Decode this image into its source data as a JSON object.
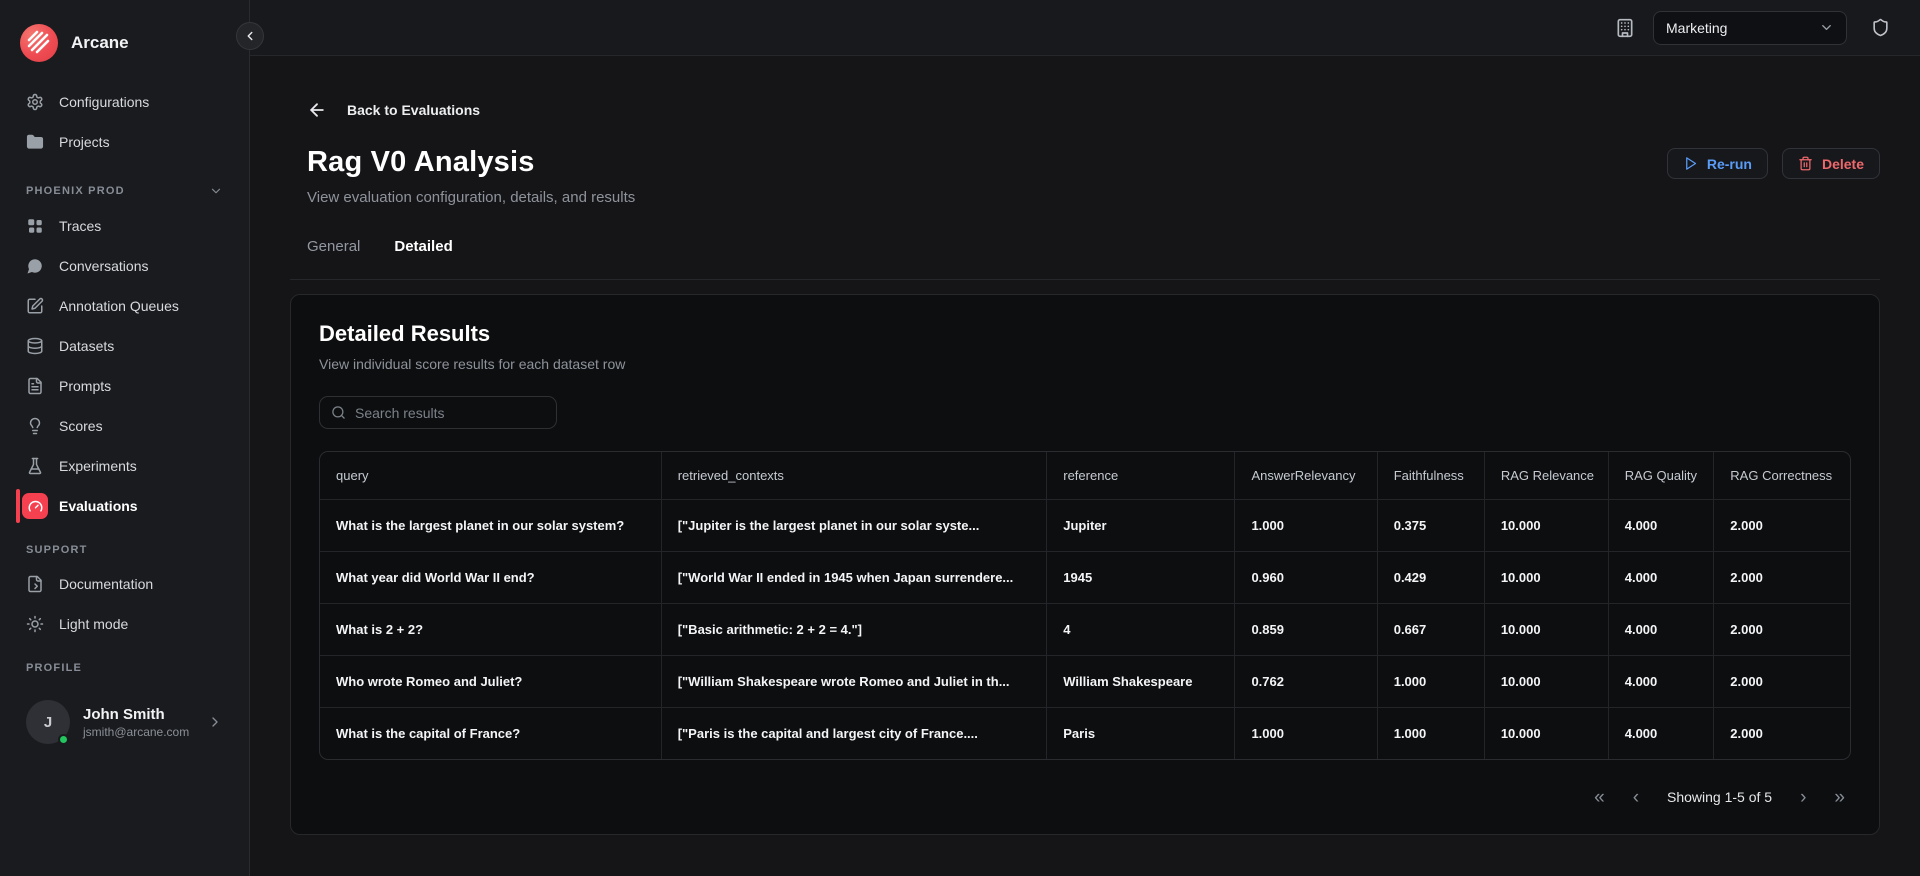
{
  "brand": {
    "name": "Arcane"
  },
  "topbar": {
    "org_selector_value": "Marketing"
  },
  "sidebar": {
    "main_items": [
      {
        "label": "Configurations",
        "icon": "gear-icon"
      },
      {
        "label": "Projects",
        "icon": "folder-icon"
      }
    ],
    "project_section_label": "PHOENIX PROD",
    "project_items": [
      {
        "label": "Traces",
        "icon": "grid-icon"
      },
      {
        "label": "Conversations",
        "icon": "chat-bubble-icon"
      },
      {
        "label": "Annotation Queues",
        "icon": "annotation-icon"
      },
      {
        "label": "Datasets",
        "icon": "database-icon"
      },
      {
        "label": "Prompts",
        "icon": "prompt-file-icon"
      },
      {
        "label": "Scores",
        "icon": "lightbulb-icon"
      },
      {
        "label": "Experiments",
        "icon": "flask-icon"
      },
      {
        "label": "Evaluations",
        "icon": "gauge-icon",
        "active": true
      }
    ],
    "support_section_label": "SUPPORT",
    "support_items": [
      {
        "label": "Documentation",
        "icon": "document-icon"
      },
      {
        "label": "Light mode",
        "icon": "sun-icon"
      }
    ],
    "profile_section_label": "PROFILE",
    "profile": {
      "initial": "J",
      "name": "John Smith",
      "email": "jsmith@arcane.com"
    }
  },
  "header": {
    "back_label": "Back to Evaluations",
    "title": "Rag V0 Analysis",
    "subtitle": "View evaluation configuration, details, and results",
    "rerun_label": "Re-run",
    "delete_label": "Delete",
    "tabs": [
      {
        "label": "General",
        "active": false
      },
      {
        "label": "Detailed",
        "active": true
      }
    ]
  },
  "results": {
    "title": "Detailed Results",
    "subtitle": "View individual score results for each dataset row",
    "search_placeholder": "Search results",
    "columns": [
      "query",
      "retrieved_contexts",
      "reference",
      "AnswerRelevancy",
      "Faithfulness",
      "RAG Relevance",
      "RAG Quality",
      "RAG Correctness"
    ],
    "rows": [
      [
        "What is the largest planet in our solar system?",
        "[\"Jupiter is the largest planet in our solar syste...",
        "Jupiter",
        "1.000",
        "0.375",
        "10.000",
        "4.000",
        "2.000"
      ],
      [
        "What year did World War II end?",
        "[\"World War II ended in 1945 when Japan surrendere...",
        "1945",
        "0.960",
        "0.429",
        "10.000",
        "4.000",
        "2.000"
      ],
      [
        "What is 2 + 2?",
        "[\"Basic arithmetic: 2 + 2 = 4.\"]",
        "4",
        "0.859",
        "0.667",
        "10.000",
        "4.000",
        "2.000"
      ],
      [
        "Who wrote Romeo and Juliet?",
        "[\"William Shakespeare wrote Romeo and Juliet in th...",
        "William Shakespeare",
        "0.762",
        "1.000",
        "10.000",
        "4.000",
        "2.000"
      ],
      [
        "What is the capital of France?",
        "[\"Paris is the capital and largest city of France....",
        "Paris",
        "1.000",
        "1.000",
        "10.000",
        "4.000",
        "2.000"
      ]
    ],
    "pagination": {
      "first": "«",
      "prev": "‹",
      "label": "Showing 1-5 of 5",
      "next": "›",
      "last": "»"
    }
  },
  "colors": {
    "accent_red": "#f4404f",
    "logo_red": "#ee4b52",
    "rerun_blue": "#5a9cf8",
    "delete_red": "#ee686c",
    "online_green": "#22c55e"
  }
}
